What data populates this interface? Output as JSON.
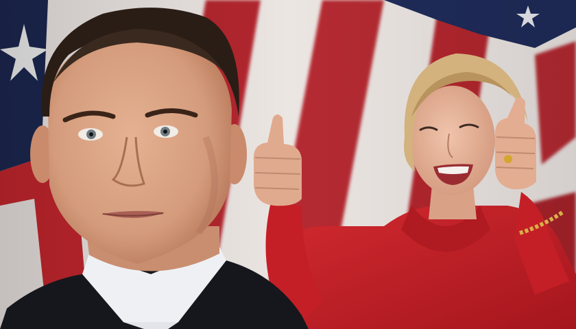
{
  "image": {
    "kind": "photo-composite",
    "subjects": [
      "man-portrait",
      "woman-thumbs-up"
    ],
    "background": "american-flag",
    "colors": {
      "flag_red": "#b3262d",
      "flag_white": "#ece6e3",
      "flag_blue": "#1f2c5a",
      "jacket_red": "#c21f26",
      "suit_dark": "#15171c",
      "skin_man": "#d9a283",
      "skin_woman": "#e8b79e",
      "hair_man": "#2a1d16",
      "hair_woman": "#d3b27e"
    }
  }
}
